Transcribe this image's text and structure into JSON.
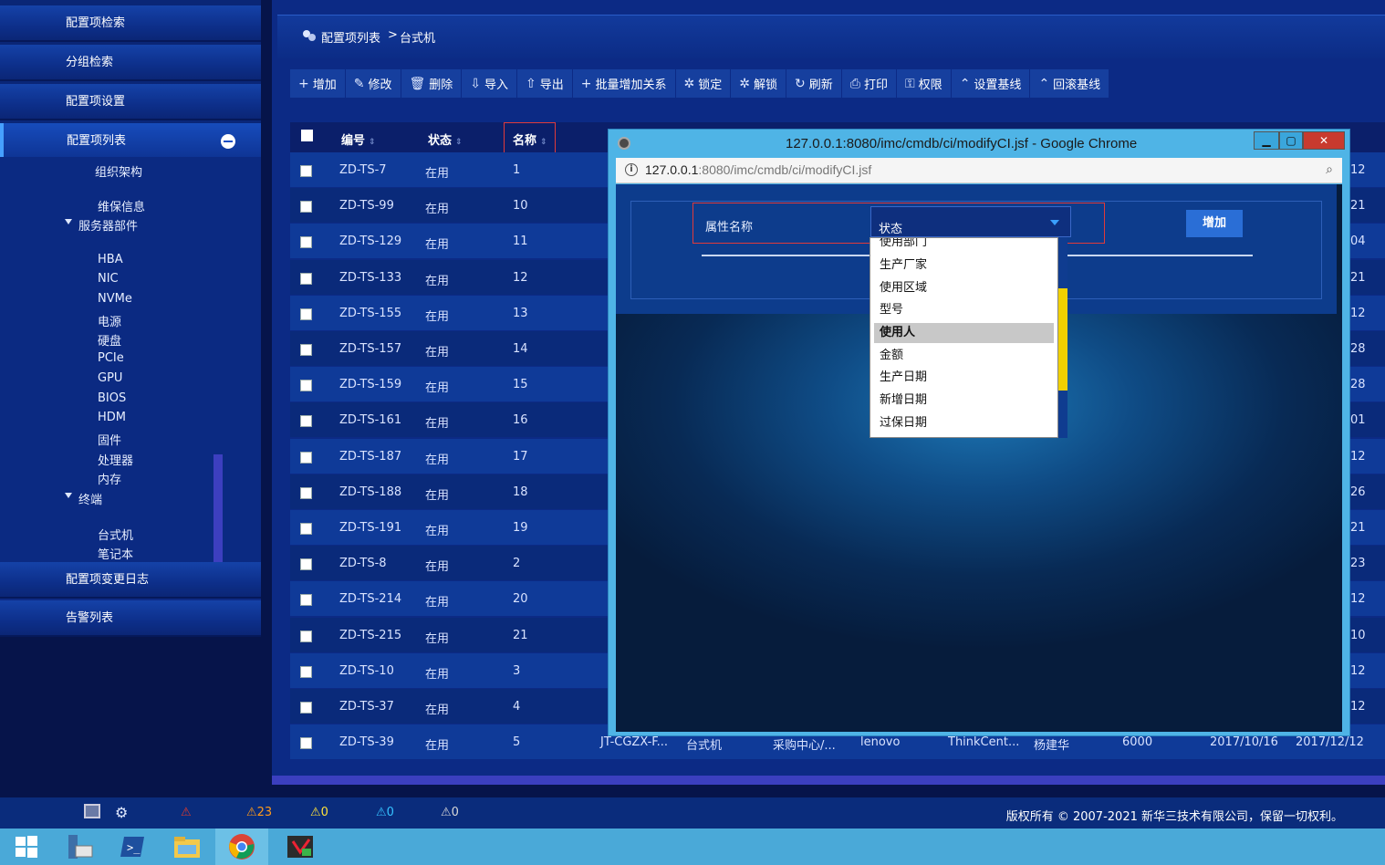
{
  "sidebar": {
    "sections": [
      {
        "label": "配置项检索"
      },
      {
        "label": "分组检索"
      },
      {
        "label": "配置项设置"
      },
      {
        "label": "配置项列表"
      },
      {
        "label": "配置项变更日志"
      },
      {
        "label": "告警列表"
      }
    ],
    "tree": {
      "org": "组织架构",
      "maint": "维保信息",
      "server_parts": "服务器部件",
      "server_children": [
        "HBA",
        "NIC",
        "NVMe",
        "电源",
        "硬盘",
        "PCIe",
        "GPU",
        "BIOS",
        "HDM",
        "固件",
        "处理器",
        "内存"
      ],
      "terminal": "终端",
      "terminal_children": [
        "台式机",
        "笔记本"
      ]
    }
  },
  "breadcrumb": {
    "root": "配置项列表",
    "sep": ">",
    "current": "台式机"
  },
  "toolbar": [
    {
      "icon": "plus-icon",
      "glyph": "+",
      "label": "增加"
    },
    {
      "icon": "edit-icon",
      "glyph": "✎",
      "label": "修改"
    },
    {
      "icon": "trash-icon",
      "glyph": "🗑",
      "label": "删除"
    },
    {
      "icon": "import-icon",
      "glyph": "⇩",
      "label": "导入"
    },
    {
      "icon": "export-icon",
      "glyph": "⇧",
      "label": "导出"
    },
    {
      "icon": "plus-icon",
      "glyph": "+",
      "label": "批量增加关系"
    },
    {
      "icon": "lock-gear-icon",
      "glyph": "✲",
      "label": "锁定"
    },
    {
      "icon": "unlock-gear-icon",
      "glyph": "✲",
      "label": "解锁"
    },
    {
      "icon": "refresh-icon",
      "glyph": "↻",
      "label": "刷新"
    },
    {
      "icon": "print-icon",
      "glyph": "⎙",
      "label": "打印"
    },
    {
      "icon": "key-icon",
      "glyph": "⚿",
      "label": "权限"
    },
    {
      "icon": "chevron-up-icon",
      "glyph": "⌃",
      "label": "设置基线"
    },
    {
      "icon": "chevron-up-icon",
      "glyph": "⌃",
      "label": "回滚基线"
    }
  ],
  "table": {
    "headers": {
      "code": "编号",
      "status": "状态",
      "name": "名称"
    },
    "rows": [
      {
        "code": "ZD-TS-7",
        "status": "在用",
        "name": "1",
        "right": "12"
      },
      {
        "code": "ZD-TS-99",
        "status": "在用",
        "name": "10",
        "right": "21"
      },
      {
        "code": "ZD-TS-129",
        "status": "在用",
        "name": "11",
        "right": "04"
      },
      {
        "code": "ZD-TS-133",
        "status": "在用",
        "name": "12",
        "right": "21"
      },
      {
        "code": "ZD-TS-155",
        "status": "在用",
        "name": "13",
        "right": "12"
      },
      {
        "code": "ZD-TS-157",
        "status": "在用",
        "name": "14",
        "right": "28"
      },
      {
        "code": "ZD-TS-159",
        "status": "在用",
        "name": "15",
        "right": "28"
      },
      {
        "code": "ZD-TS-161",
        "status": "在用",
        "name": "16",
        "right": "01"
      },
      {
        "code": "ZD-TS-187",
        "status": "在用",
        "name": "17",
        "right": "12"
      },
      {
        "code": "ZD-TS-188",
        "status": "在用",
        "name": "18",
        "right": "26"
      },
      {
        "code": "ZD-TS-191",
        "status": "在用",
        "name": "19",
        "right": "21"
      },
      {
        "code": "ZD-TS-8",
        "status": "在用",
        "name": "2",
        "right": "23"
      },
      {
        "code": "ZD-TS-214",
        "status": "在用",
        "name": "20",
        "right": "12"
      },
      {
        "code": "ZD-TS-215",
        "status": "在用",
        "name": "21",
        "right": "10"
      },
      {
        "code": "ZD-TS-10",
        "status": "在用",
        "name": "3",
        "right": "12"
      },
      {
        "code": "ZD-TS-37",
        "status": "在用",
        "name": "4",
        "right": "12"
      }
    ],
    "last_row": {
      "code": "ZD-TS-39",
      "status": "在用",
      "name": "5",
      "col4": "JT-CGZX-F...",
      "col5": "台式机",
      "col6": "采购中心/...",
      "col7": "lenovo",
      "col8": "ThinkCent...",
      "col9": "杨建华",
      "col10": "6000",
      "col11": "2017/10/16",
      "col12": "2017/12/12"
    }
  },
  "popup": {
    "title": "127.0.0.1:8080/imc/cmdb/ci/modifyCI.jsf - Google Chrome",
    "url_host": "127.0.0.1",
    "url_rest": ":8080/imc/cmdb/ci/modifyCI.jsf",
    "form": {
      "label": "属性名称",
      "selected": "状态",
      "add_label": "增加"
    },
    "dropdown": [
      "使用部门",
      "生产厂家",
      "使用区域",
      "型号",
      "使用人",
      "金额",
      "生产日期",
      "新增日期",
      "过保日期"
    ],
    "dropdown_selected": "使用人"
  },
  "status": {
    "alarms": [
      {
        "color": "#e23b2b",
        "count": ""
      },
      {
        "color": "#ff9a1a",
        "count": "23"
      },
      {
        "color": "#ffe23a",
        "count": "0"
      },
      {
        "color": "#35c2ff",
        "count": "0"
      },
      {
        "color": "#d8d8d8",
        "count": "0"
      }
    ],
    "copyright": "版权所有 © 2007-2021 新华三技术有限公司，保留一切权利。"
  },
  "taskbar": {
    "apps": [
      "windows-start-icon",
      "server-manager-icon",
      "powershell-icon",
      "file-explorer-icon",
      "chrome-icon",
      "app-icon"
    ]
  }
}
